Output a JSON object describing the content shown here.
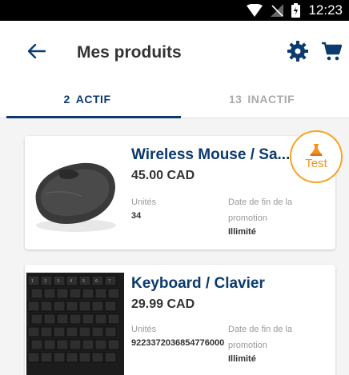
{
  "status_bar": {
    "time": "12:23"
  },
  "header": {
    "title": "Mes produits"
  },
  "tabs": [
    {
      "count": "2",
      "label": "ACTIF"
    },
    {
      "count": "13",
      "label": "INACTIF"
    }
  ],
  "products": [
    {
      "name": "Wireless Mouse / Sa...",
      "price": "45.00 CAD",
      "units_label": "Unités",
      "units_value": "34",
      "promo_label": "Date de fin de la promotion",
      "promo_value": "Illimité"
    },
    {
      "name": "Keyboard / Clavier",
      "price": "29.99 CAD",
      "units_label": "Unités",
      "units_value": "9223372036854776000",
      "promo_label": "Date de fin de la promotion",
      "promo_value": "Illimité"
    }
  ],
  "test_badge": {
    "label": "Test"
  },
  "colors": {
    "primary": "#0b3a6e",
    "accent": "#f5a623",
    "inactive": "#aaaaaa"
  }
}
